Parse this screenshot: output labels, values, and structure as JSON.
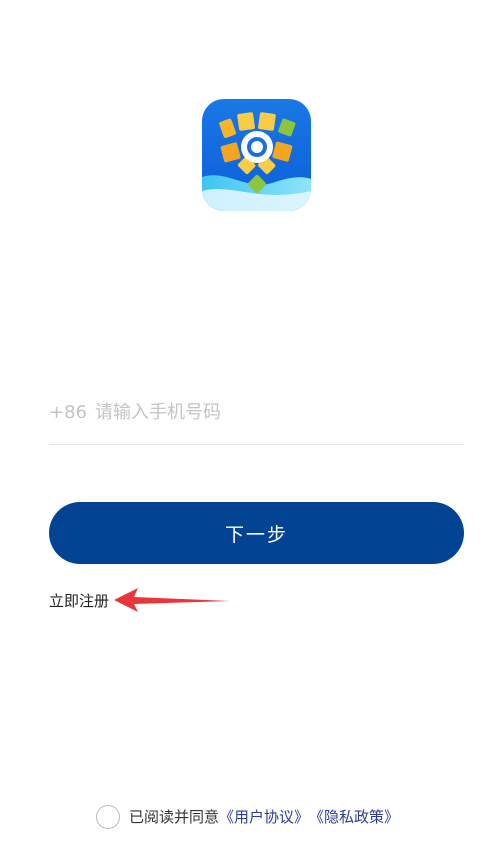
{
  "login": {
    "phone_prefix": "+86",
    "phone_placeholder": "请输入手机号码",
    "next_button_label": "下一步",
    "register_label": "立即注册"
  },
  "agreement": {
    "prefix_text": "已阅读并同意",
    "user_agreement_label": "《用户协议》",
    "privacy_policy_label": "《隐私政策》"
  },
  "colors": {
    "primary": "#034394",
    "arrow": "#e8363a",
    "link": "#2b3d9a"
  },
  "icons": {
    "logo": "app-logo-icon",
    "arrow": "red-arrow-annotation",
    "checkbox": "agreement-radio"
  }
}
